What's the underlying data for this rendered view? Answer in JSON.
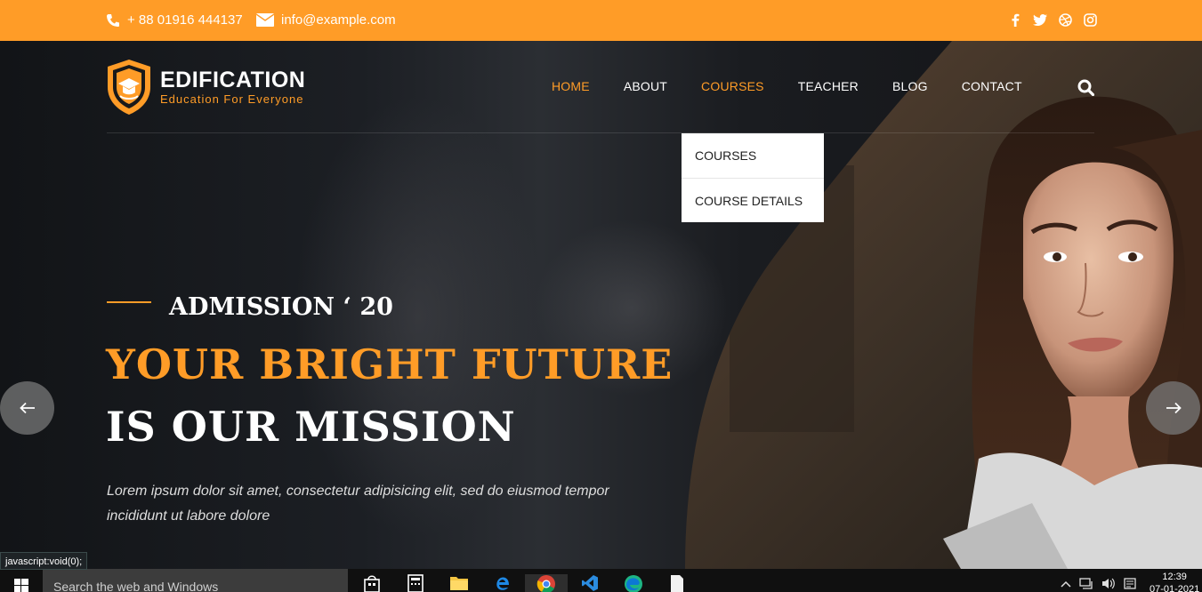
{
  "topbar": {
    "phone": "+ 88 01916 444137",
    "email": "info@example.com",
    "social_icons": [
      "facebook-icon",
      "twitter-icon",
      "dribbble-icon",
      "instagram-icon"
    ]
  },
  "brand": {
    "name": "EDIFICATION",
    "tagline": "Education For Everyone"
  },
  "nav": {
    "items": [
      {
        "label": "HOME",
        "active": true
      },
      {
        "label": "ABOUT",
        "active": false
      },
      {
        "label": "COURSES",
        "active": false
      },
      {
        "label": "TEACHER",
        "active": false
      },
      {
        "label": "BLOG",
        "active": false
      },
      {
        "label": "CONTACT",
        "active": false
      }
    ],
    "dropdown": [
      "COURSES",
      "COURSE DETAILS"
    ]
  },
  "hero": {
    "kicker": "ADMISSION ‘ 20",
    "headline_1": "YOUR BRIGHT FUTURE",
    "headline_2": "IS OUR MISSION",
    "description": "Lorem ipsum dolor sit amet, consectetur adipisicing elit, sed do eiusmod tempor incididunt ut labore dolore"
  },
  "status_tip": "javascript:void(0);",
  "taskbar": {
    "search_placeholder": "Search the web and Windows",
    "time": "12:39",
    "date": "07-01-2021"
  },
  "colors": {
    "accent": "#ff9c27",
    "topbar_bg": "#ff9c27",
    "taskbar_bg": "#101010"
  }
}
